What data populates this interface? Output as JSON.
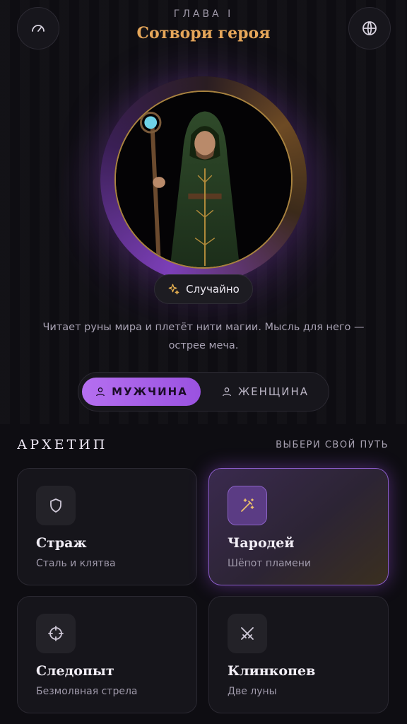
{
  "header": {
    "chapter": "ГЛАВА I",
    "title": "Сотвори героя",
    "left_icon": "speedometer-icon",
    "right_icon": "globe-icon"
  },
  "hero": {
    "portrait": "hooded-mage-with-staff",
    "random_label": "Случайно",
    "random_icon": "sparkles-icon",
    "description": "Читает руны мира и плетёт нити магии. Мысль для него — острее меча."
  },
  "gender": {
    "options": [
      {
        "label": "МУЖЧИНА",
        "icon": "person-icon",
        "selected": true
      },
      {
        "label": "ЖЕНЩИНА",
        "icon": "person-icon",
        "selected": false
      }
    ]
  },
  "archetype": {
    "title": "АРХЕТИП",
    "hint": "ВЫБЕРИ СВОЙ ПУТЬ",
    "cards": [
      {
        "title": "Страж",
        "subtitle": "Сталь и клятва",
        "icon": "shield-icon",
        "selected": false
      },
      {
        "title": "Чародей",
        "subtitle": "Шёпот пламени",
        "icon": "magic-wand-icon",
        "selected": true
      },
      {
        "title": "Следопыт",
        "subtitle": "Безмолвная стрела",
        "icon": "crosshair-icon",
        "selected": false
      },
      {
        "title": "Клинкопев",
        "subtitle": "Две луны",
        "icon": "crossed-swords-icon",
        "selected": false
      }
    ]
  },
  "colors": {
    "accent_gold": "#e6a75a",
    "accent_purple": "#b56ff0",
    "background": "#0e0d12"
  }
}
